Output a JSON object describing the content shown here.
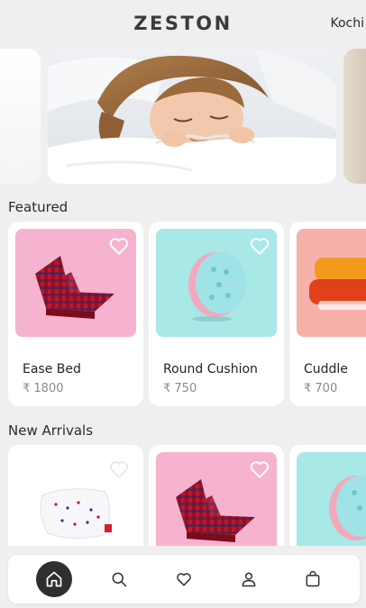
{
  "header": {
    "brand": "ZESTON",
    "location": "Kochi"
  },
  "sections": {
    "featured": {
      "title": "Featured",
      "products": [
        {
          "name": "Ease Bed",
          "price": "₹ 1800"
        },
        {
          "name": "Round Cushion",
          "price": "₹ 750"
        },
        {
          "name": "Cuddle",
          "price": "₹ 700"
        }
      ]
    },
    "new_arrivals": {
      "title": "New Arrivals"
    }
  },
  "nav": {
    "items": [
      "home-icon",
      "search-icon",
      "heart-icon",
      "user-icon",
      "bag-icon"
    ],
    "active": "home-icon"
  },
  "colors": {
    "background": "#efefef",
    "pink_tile": "#f6b3cf",
    "teal_tile": "#a8e8e6",
    "peach_tile": "#f6b1aa",
    "nav_active": "#2f2f2f"
  }
}
